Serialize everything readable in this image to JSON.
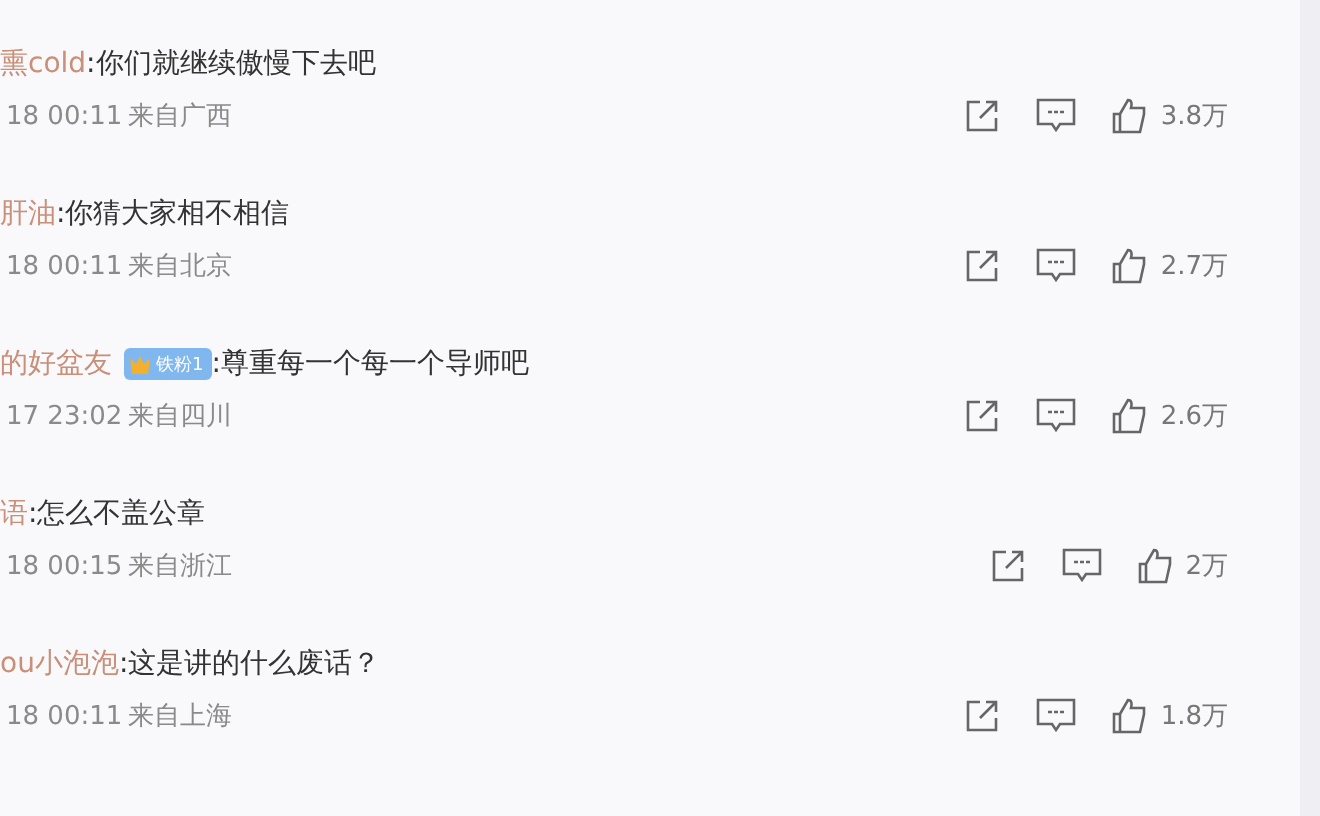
{
  "comments": [
    {
      "user": "熏cold",
      "text": ":你们就继续傲慢下去吧",
      "time": "18 00:11",
      "location": "来自广西",
      "likes": "3.8万"
    },
    {
      "user": "肝油",
      "text": ":你猜大家相不相信",
      "time": "18 00:11",
      "location": "来自北京",
      "likes": "2.7万"
    },
    {
      "user": "的好盆友",
      "badge": "铁粉1",
      "text": " :尊重每一个每一个导师吧",
      "time": "17 23:02",
      "location": "来自四川",
      "likes": "2.6万"
    },
    {
      "user": "语",
      "text": ":怎么不盖公章",
      "time": "18 00:15",
      "location": "来自浙江",
      "likes": "2万"
    },
    {
      "user": "ou小泡泡",
      "text": ":这是讲的什么废话？",
      "time": "18 00:11",
      "location": "来自上海",
      "likes": "1.8万"
    }
  ]
}
